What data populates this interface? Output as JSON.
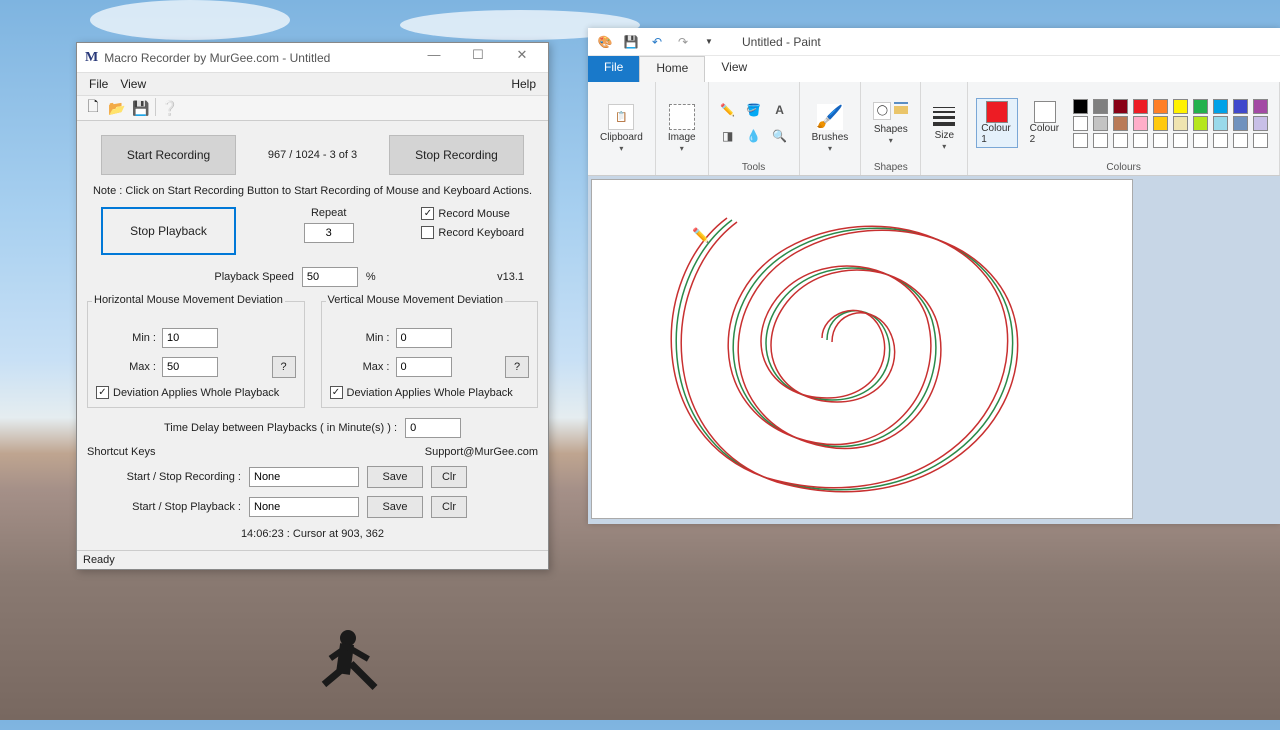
{
  "macro": {
    "title_icon": "M",
    "title": "Macro Recorder by MurGee.com - Untitled",
    "menu": {
      "file": "File",
      "view": "View",
      "help": "Help"
    },
    "start_recording": "Start Recording",
    "stop_recording": "Stop Recording",
    "counter": "967 / 1024 - 3 of 3",
    "note": "Note : Click on Start Recording Button to Start Recording of Mouse and Keyboard Actions.",
    "stop_playback": "Stop Playback",
    "repeat_label": "Repeat",
    "repeat_value": "3",
    "record_mouse": "Record Mouse",
    "record_keyboard": "Record Keyboard",
    "playback_speed_label": "Playback Speed",
    "playback_speed_value": "50",
    "playback_speed_unit": "%",
    "version": "v13.1",
    "hdev": {
      "legend": "Horizontal Mouse Movement Deviation",
      "min_label": "Min :",
      "min_value": "10",
      "max_label": "Max :",
      "max_value": "50",
      "whole": "Deviation Applies Whole Playback"
    },
    "vdev": {
      "legend": "Vertical Mouse Movement Deviation",
      "min_label": "Min :",
      "min_value": "0",
      "max_label": "Max :",
      "max_value": "0",
      "whole": "Deviation Applies Whole Playback"
    },
    "time_delay_label": "Time Delay between Playbacks ( in Minute(s) ) :",
    "time_delay_value": "0",
    "shortcut_header": "Shortcut Keys",
    "support": "Support@MurGee.com",
    "sk_recording_label": "Start / Stop Recording :",
    "sk_playback_label": "Start / Stop Playback :",
    "sk_value": "None",
    "save": "Save",
    "clr": "Clr",
    "cursor_status": "14:06:23 : Cursor at 903, 362",
    "status": "Ready",
    "question": "?"
  },
  "paint": {
    "title": "Untitled - Paint",
    "tabs": {
      "file": "File",
      "home": "Home",
      "view": "View"
    },
    "groups": {
      "clipboard": "Clipboard",
      "image": "Image",
      "tools": "Tools",
      "brushes": "Brushes",
      "shapes": "Shapes",
      "size": "Size",
      "colour1": "Colour 1",
      "colour2": "Colour 2",
      "colours": "Colours"
    },
    "palette_row1": [
      "#000000",
      "#7f7f7f",
      "#880015",
      "#ed1c24",
      "#ff7f27",
      "#fff200",
      "#22b14c",
      "#00a2e8",
      "#3f48cc",
      "#a349a4"
    ],
    "palette_row2": [
      "#ffffff",
      "#c3c3c3",
      "#b97a57",
      "#ffaec9",
      "#ffc90e",
      "#efe4b0",
      "#b5e61d",
      "#99d9ea",
      "#7092be",
      "#c8bfe7"
    ],
    "palette_row3": [
      "#ffffff",
      "#ffffff",
      "#ffffff",
      "#ffffff",
      "#ffffff",
      "#ffffff",
      "#ffffff",
      "#ffffff",
      "#ffffff",
      "#ffffff"
    ],
    "colour1_fill": "#ed1c24",
    "colour2_fill": "#ffffff"
  }
}
